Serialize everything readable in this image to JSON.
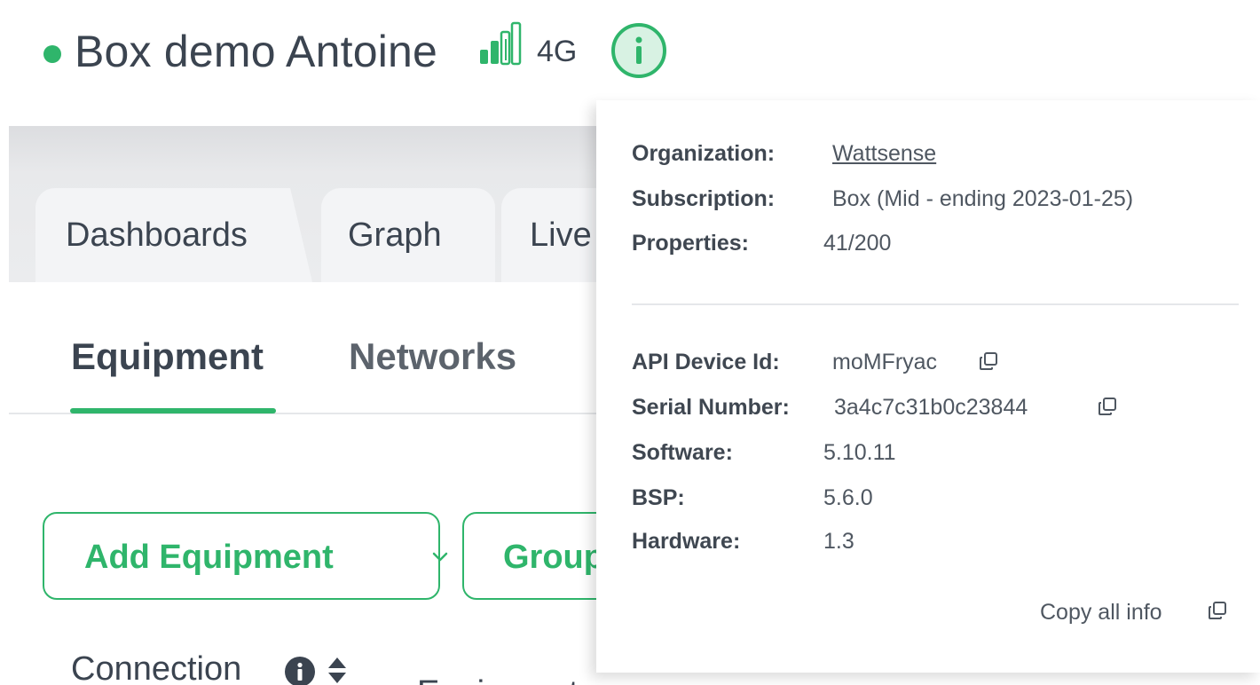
{
  "header": {
    "device_name": "Box demo Antoine",
    "network_type": "4G",
    "status_color": "#2fb56b"
  },
  "tabs": [
    {
      "label": "Dashboards"
    },
    {
      "label": "Graph"
    },
    {
      "label": "Live"
    }
  ],
  "subtabs": [
    {
      "label": "Equipment",
      "active": true
    },
    {
      "label": "Networks",
      "active": false
    }
  ],
  "actions": {
    "add_equipment": "Add Equipment",
    "group": "Group"
  },
  "table": {
    "connection_header": "Connection",
    "next_header_peek": "Equipment"
  },
  "info_popover": {
    "organization_label": "Organization:",
    "organization_value": "Wattsense",
    "subscription_label": "Subscription:",
    "subscription_value": "Box (Mid - ending 2023-01-25)",
    "properties_label": "Properties:",
    "properties_value": "41/200",
    "api_device_id_label": "API Device Id:",
    "api_device_id_value": "moMFryac",
    "serial_number_label": "Serial Number:",
    "serial_number_value": "3a4c7c31b0c23844",
    "software_label": "Software:",
    "software_value": "5.10.11",
    "bsp_label": "BSP:",
    "bsp_value": "5.6.0",
    "hardware_label": "Hardware:",
    "hardware_value": "1.3",
    "copy_all_label": "Copy all info"
  },
  "colors": {
    "accent": "#2fb56b",
    "text": "#3b4450",
    "tab_bg": "#f3f4f6"
  }
}
